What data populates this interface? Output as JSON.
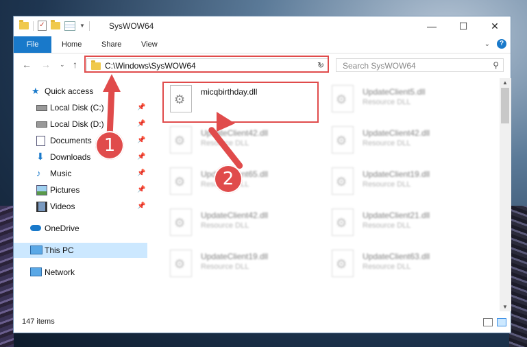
{
  "window": {
    "title": "SysWOW64",
    "controls": {
      "minimize": "—",
      "maximize": "☐",
      "close": "✕"
    }
  },
  "ribbon": {
    "tabs": [
      "File",
      "Home",
      "Share",
      "View"
    ]
  },
  "address": {
    "path": "C:\\Windows\\SysWOW64",
    "search_placeholder": "Search SysWOW64"
  },
  "navpane": {
    "items": [
      {
        "label": "Quick access",
        "icon": "star-icon",
        "pinned": false
      },
      {
        "label": "Local Disk (C:)",
        "icon": "drive-icon",
        "pinned": true
      },
      {
        "label": "Local Disk (D:)",
        "icon": "drive-icon",
        "pinned": true
      },
      {
        "label": "Documents",
        "icon": "documents-icon",
        "pinned": true
      },
      {
        "label": "Downloads",
        "icon": "download-icon",
        "pinned": true
      },
      {
        "label": "Music",
        "icon": "music-icon",
        "pinned": true
      },
      {
        "label": "Pictures",
        "icon": "pictures-icon",
        "pinned": true
      },
      {
        "label": "Videos",
        "icon": "videos-icon",
        "pinned": true
      },
      {
        "label": "OneDrive",
        "icon": "cloud-icon",
        "pinned": false
      },
      {
        "label": "This PC",
        "icon": "computer-icon",
        "pinned": false,
        "selected": true
      },
      {
        "label": "Network",
        "icon": "network-icon",
        "pinned": false
      }
    ]
  },
  "files": {
    "featured": {
      "name": "micqbirthday.dll"
    },
    "items": [
      {
        "name": "UpdateClient5.dll",
        "type": "Resource DLL"
      },
      {
        "name": "UpdateClient42.dll",
        "type": "Resource DLL"
      },
      {
        "name": "UpdateClient42.dll",
        "type": "Resource DLL"
      },
      {
        "name": "UpdateClient65.dll",
        "type": "Resource DLL"
      },
      {
        "name": "UpdateClient19.dll",
        "type": "Resource DLL"
      },
      {
        "name": "UpdateClient42.dll",
        "type": "Resource DLL"
      },
      {
        "name": "UpdateClient21.dll",
        "type": "Resource DLL"
      },
      {
        "name": "UpdateClient19.dll",
        "type": "Resource DLL"
      },
      {
        "name": "UpdateClient63.dll",
        "type": "Resource DLL"
      }
    ]
  },
  "status": {
    "count": "147 items"
  },
  "annotations": {
    "step1": "1",
    "step2": "2"
  },
  "colors": {
    "accent": "#1979ca",
    "highlight": "#e04b4b",
    "selected": "#cce8ff"
  }
}
